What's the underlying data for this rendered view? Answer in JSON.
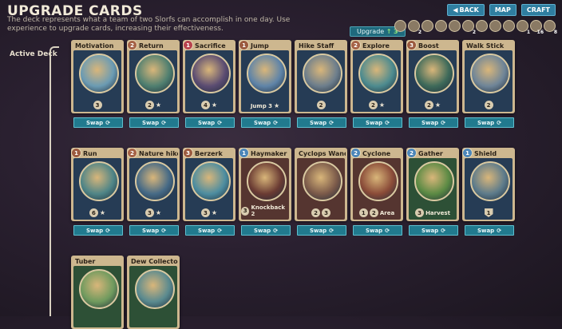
{
  "header": {
    "title": "UPGRADE CARDS",
    "description": "The deck represents what a team of two Slorfs can accomplish in one day. Use experience to upgrade cards, increasing their effectiveness."
  },
  "top_buttons": {
    "back": "BACK",
    "map": "MAP",
    "craft": "CRAFT"
  },
  "upgrade": {
    "label": "Upgrade",
    "value": "3"
  },
  "resources": [
    {
      "icon": "stick-icon",
      "count": ""
    },
    {
      "icon": "nut-icon",
      "count": "2"
    },
    {
      "icon": "leaf-icon",
      "count": ""
    },
    {
      "icon": "stick-icon",
      "count": ""
    },
    {
      "icon": "bug-icon",
      "count": ""
    },
    {
      "icon": "shell-icon",
      "count": "2"
    },
    {
      "icon": "shell-icon",
      "count": ""
    },
    {
      "icon": "rock-icon",
      "count": ""
    },
    {
      "icon": "flower-icon",
      "count": ""
    },
    {
      "icon": "drop-icon",
      "count": "1"
    },
    {
      "icon": "exp-icon",
      "count": "16"
    },
    {
      "icon": "gem-icon",
      "count": "8"
    }
  ],
  "sidebar": {
    "active_deck": "Active Deck"
  },
  "swap_label": "Swap",
  "cards": [
    {
      "name": "Motivation",
      "cost": "",
      "cost_type": "",
      "stat": "3",
      "stat_kind": "badge",
      "extra": "",
      "lock": false,
      "body": "blue",
      "art": "#6b9bb3"
    },
    {
      "name": "Return",
      "cost": "2",
      "cost_type": "c2",
      "stat": "2",
      "stat_kind": "badge-star",
      "extra": "",
      "lock": false,
      "body": "blue",
      "art": "#4f7f70"
    },
    {
      "name": "Sacrifice",
      "cost": "1",
      "cost_type": "c1",
      "stat": "4",
      "stat_kind": "badge-star",
      "extra": "",
      "lock": false,
      "body": "blue",
      "art": "#5b4c72"
    },
    {
      "name": "Jump",
      "cost": "1",
      "cost_type": "c3",
      "stat": "3",
      "stat_kind": "text-star",
      "extra": "Jump",
      "lock": false,
      "body": "blue",
      "art": "#5f84a8"
    },
    {
      "name": "Hike Staff",
      "cost": "",
      "cost_type": "",
      "stat": "2",
      "stat_kind": "badge",
      "extra": "",
      "lock": false,
      "body": "blue",
      "art": "#6d7e8c"
    },
    {
      "name": "Explore",
      "cost": "2",
      "cost_type": "c2",
      "stat": "2",
      "stat_kind": "badge-star",
      "extra": "",
      "lock": false,
      "body": "blue",
      "art": "#4d8b8f"
    },
    {
      "name": "Boost",
      "cost": "3",
      "cost_type": "c3",
      "stat": "2",
      "stat_kind": "badge-star",
      "extra": "",
      "lock": false,
      "body": "blue",
      "art": "#3e6a5a"
    },
    {
      "name": "Walk Stick",
      "cost": "",
      "cost_type": "",
      "stat": "2",
      "stat_kind": "badge",
      "extra": "",
      "lock": true,
      "body": "blue",
      "art": "#6f8598"
    },
    {
      "name": "Run",
      "cost": "1",
      "cost_type": "c3",
      "stat": "6",
      "stat_kind": "badge-star",
      "extra": "",
      "lock": false,
      "body": "blue",
      "art": "#4f8587"
    },
    {
      "name": "Nature hike",
      "cost": "2",
      "cost_type": "c2",
      "stat": "3",
      "stat_kind": "badge-star",
      "extra": "",
      "lock": false,
      "body": "blue",
      "art": "#466a86"
    },
    {
      "name": "Berzerk",
      "cost": "3",
      "cost_type": "c3",
      "stat": "3",
      "stat_kind": "badge-star",
      "extra": "",
      "lock": false,
      "body": "blue",
      "art": "#4d8da0"
    },
    {
      "name": "Haymaker",
      "cost": "1",
      "cost_type": "cb",
      "stat": "3",
      "stat_kind": "text",
      "extra": "Knockback 2",
      "lock": true,
      "body": "red",
      "art": "#6a3b33"
    },
    {
      "name": "Cyclops Wand",
      "cost": "",
      "cost_type": "",
      "stat": "2 3",
      "stat_kind": "pair",
      "extra": "",
      "lock": true,
      "body": "red",
      "art": "#7b5a4a"
    },
    {
      "name": "Cyclone",
      "cost": "2",
      "cost_type": "cb",
      "stat": "1 2",
      "stat_kind": "pair-text",
      "extra": "Area",
      "lock": false,
      "body": "red",
      "art": "#8a4b38"
    },
    {
      "name": "Gather",
      "cost": "2",
      "cost_type": "cb",
      "stat": "3",
      "stat_kind": "text",
      "extra": "Harvest",
      "lock": false,
      "body": "green",
      "art": "#5b8a44"
    },
    {
      "name": "Shield",
      "cost": "1",
      "cost_type": "cb",
      "stat": "1",
      "stat_kind": "shield",
      "extra": "",
      "lock": true,
      "body": "blue",
      "art": "#5d7b8b"
    },
    {
      "name": "Tuber",
      "cost": "",
      "cost_type": "",
      "stat": "",
      "stat_kind": "none",
      "extra": "",
      "lock": true,
      "body": "green",
      "art": "#6f9a5e"
    },
    {
      "name": "Dew Collector",
      "cost": "",
      "cost_type": "",
      "stat": "",
      "stat_kind": "none",
      "extra": "",
      "lock": true,
      "body": "green",
      "art": "#5a8a8f"
    }
  ]
}
